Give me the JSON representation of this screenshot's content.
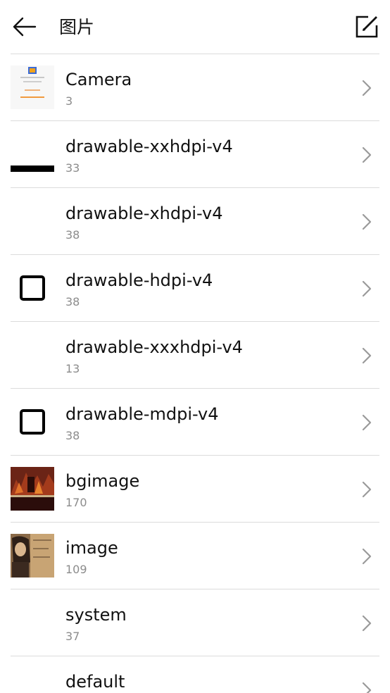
{
  "header": {
    "title": "图片",
    "back_icon": "arrow-left-icon",
    "edit_icon": "edit-square-icon"
  },
  "colors": {
    "divider": "#dcdcdc",
    "count_text": "#8c8c8c",
    "chevron": "#9a9a9a"
  },
  "albums": [
    {
      "name": "Camera",
      "count": "3",
      "thumb": "camera-thumbnail"
    },
    {
      "name": "drawable-xxhdpi-v4",
      "count": "33",
      "thumb": "black-bar-thumbnail"
    },
    {
      "name": "drawable-xhdpi-v4",
      "count": "38",
      "thumb": "blank-thumbnail"
    },
    {
      "name": "drawable-hdpi-v4",
      "count": "38",
      "thumb": "checkbox-thumbnail"
    },
    {
      "name": "drawable-xxxhdpi-v4",
      "count": "13",
      "thumb": "blank-thumbnail"
    },
    {
      "name": "drawable-mdpi-v4",
      "count": "38",
      "thumb": "checkbox-thumbnail"
    },
    {
      "name": "bgimage",
      "count": "170",
      "thumb": "game-background-thumbnail"
    },
    {
      "name": "image",
      "count": "109",
      "thumb": "character-art-thumbnail"
    },
    {
      "name": "system",
      "count": "37",
      "thumb": "blank-thumbnail"
    },
    {
      "name": "default",
      "count": "",
      "thumb": "blank-thumbnail"
    }
  ]
}
